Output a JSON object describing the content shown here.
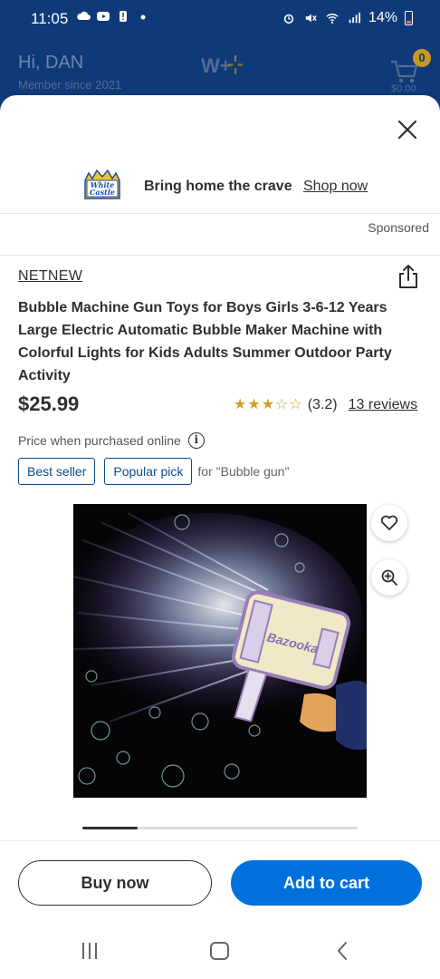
{
  "status_bar": {
    "time": "11:05",
    "battery": "14%"
  },
  "header": {
    "greeting": "Hi, DAN",
    "member_since": "Member since 2021",
    "cart_count": "0",
    "cart_total": "$0.00"
  },
  "ad": {
    "text": "Bring home the crave",
    "link": "Shop now",
    "sponsored": "Sponsored",
    "logo_text_1": "White",
    "logo_text_2": "Castle"
  },
  "product": {
    "brand": "NETNEW",
    "title": "Bubble Machine Gun Toys for Boys Girls 3-6-12 Years Large Electric Automatic Bubble Maker Machine with Colorful Lights  for Kids Adults Summer Outdoor Party Activity",
    "price": "$25.99",
    "rating_value": "(3.2)",
    "rating_stars": 3.2,
    "reviews": "13 reviews",
    "price_note": "Price when purchased online",
    "tags": [
      "Best seller",
      "Popular pick"
    ],
    "tag_note": "for \"Bubble gun\"",
    "image_label": "Bazooka",
    "image_count": 4,
    "image_index": 1
  },
  "actions": {
    "buy_now": "Buy now",
    "add_to_cart": "Add to cart"
  },
  "colors": {
    "primary": "#0071dc",
    "header_bg": "#0f3a7a",
    "star": "#c9a21f",
    "tag": "#0b4a8b"
  }
}
